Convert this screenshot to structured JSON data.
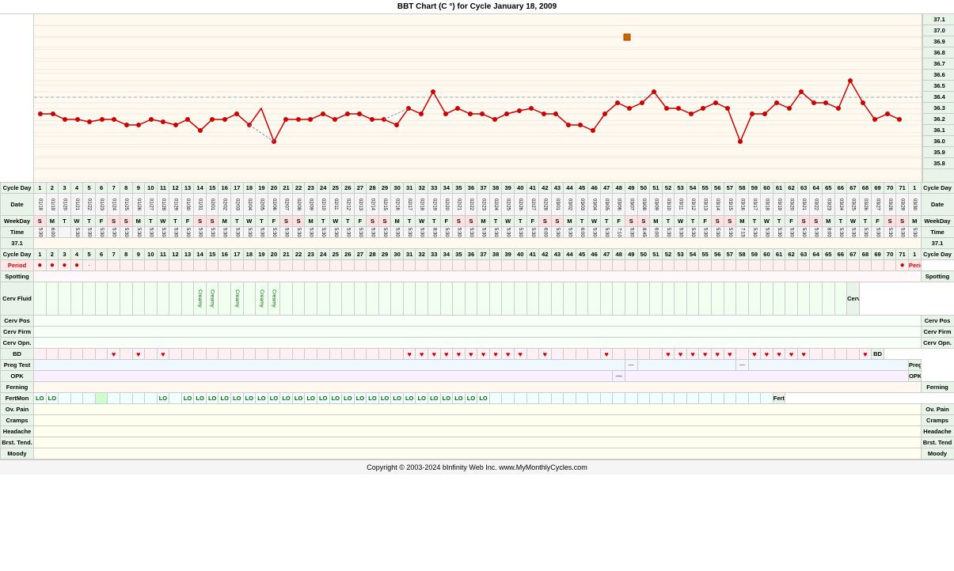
{
  "title": "BBT Chart (C °) for Cycle January 18, 2009",
  "copyright": "Copyright © 2003-2024 bInfinity Web Inc.   www.MyMonthlyCycles.com",
  "cycle_days": [
    "1",
    "2",
    "3",
    "4",
    "5",
    "6",
    "7",
    "8",
    "9",
    "10",
    "11",
    "12",
    "13",
    "14",
    "15",
    "16",
    "17",
    "18",
    "19",
    "20",
    "21",
    "22",
    "23",
    "24",
    "25",
    "26",
    "27",
    "28",
    "29",
    "30",
    "31",
    "32",
    "33",
    "34",
    "35",
    "36",
    "37",
    "38",
    "39",
    "40",
    "41",
    "42",
    "43",
    "44",
    "45",
    "46",
    "47",
    "48",
    "49",
    "50",
    "51",
    "52",
    "53",
    "54",
    "55",
    "56",
    "57",
    "58",
    "59",
    "60",
    "61",
    "62",
    "63",
    "64",
    "65",
    "66",
    "67",
    "68",
    "69",
    "70",
    "71",
    "1"
  ],
  "dates": [
    "01/18",
    "01/19",
    "01/20",
    "01/21",
    "01/22",
    "01/23",
    "01/24",
    "01/25",
    "01/26",
    "01/27",
    "01/28",
    "01/29",
    "01/30",
    "01/31",
    "02/02",
    "02/03",
    "02/04",
    "02/05",
    "02/06",
    "02/07",
    "02/08",
    "02/09",
    "02/10",
    "02/11",
    "02/12",
    "02/13",
    "02/14",
    "02/15",
    "02/16",
    "02/17",
    "02/18",
    "02/19",
    "02/20",
    "02/21",
    "02/22",
    "02/23",
    "02/24",
    "02/25",
    "02/26",
    "02/27",
    "02/28",
    "03/01",
    "03/02",
    "03/03",
    "03/04",
    "03/05",
    "03/06",
    "03/07",
    "03/08",
    "03/09",
    "03/10",
    "03/11",
    "03/12",
    "03/13",
    "03/14",
    "03/15",
    "03/16",
    "03/17",
    "03/18",
    "03/19",
    "03/20",
    "03/21",
    "03/22",
    "03/23",
    "03/24",
    "03/25",
    "03/26",
    "03/27",
    "03/28",
    "03/29",
    "03/30"
  ],
  "weekdays": [
    "S",
    "M",
    "T",
    "W",
    "T",
    "F",
    "S",
    "S",
    "M",
    "T",
    "W",
    "T",
    "F",
    "S",
    "S",
    "M",
    "T",
    "W",
    "T",
    "F",
    "S",
    "S",
    "M",
    "T",
    "W",
    "T",
    "F",
    "S",
    "S",
    "M",
    "T",
    "W",
    "T",
    "F",
    "S",
    "S",
    "M",
    "T",
    "W",
    "T",
    "F",
    "S",
    "S",
    "M",
    "T",
    "W",
    "T",
    "F",
    "S",
    "S",
    "M",
    "T",
    "W",
    "T",
    "F",
    "S",
    "S",
    "M",
    "T",
    "W",
    "T",
    "F",
    "S",
    "S",
    "M",
    "T",
    "W",
    "T",
    "F",
    "S",
    "S",
    "M"
  ],
  "temp_labels": [
    "37.1",
    "37.0",
    "36.9",
    "36.8",
    "36.7",
    "36.6",
    "36.5",
    "36.4",
    "36.3",
    "36.2",
    "36.1",
    "36.0",
    "35.9",
    "35.8"
  ],
  "row_labels": {
    "cycle_day": "Cycle Day",
    "date": "Date",
    "weekday": "WeekDay",
    "time": "Time",
    "period": "Period",
    "spotting": "Spotting",
    "cerv_fluid": "Cerv Fluid",
    "cerv_pos": "Cerv Pos",
    "cerv_firm": "Cerv Firm",
    "cerv_opn": "Cerv Opn.",
    "bd": "BD",
    "preg_test": "Preg Test",
    "opk": "OPK",
    "ferning": "Ferning",
    "fertmon": "FertMon",
    "ov_pain": "Ov. Pain",
    "cramps": "Cramps",
    "headache": "Headache",
    "brst_tend": "Brst. Tend.",
    "moody": "Moody"
  }
}
